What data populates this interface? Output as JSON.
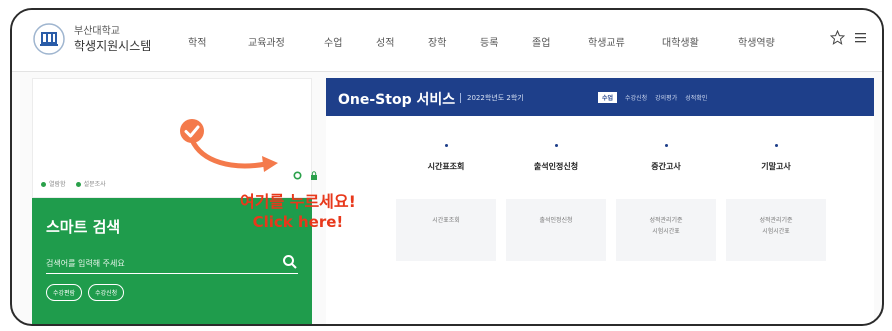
{
  "header": {
    "logo_line1": "부산대학교",
    "logo_line2": "학생지원시스템",
    "nav": [
      "학적",
      "교육과정",
      "수업",
      "성적",
      "장학",
      "등록",
      "졸업",
      "학생교류",
      "대학생활",
      "학생역량"
    ]
  },
  "left": {
    "meta": [
      "열람함",
      "설문조사"
    ]
  },
  "smart_search": {
    "title": "스마트 검색",
    "placeholder": "검색어를 입력해 주세요",
    "chips": [
      "수강편람",
      "수강신청"
    ]
  },
  "service": {
    "title": "One-Stop 서비스",
    "term": "2022학년도 2학기",
    "tabs": [
      "수업",
      "수강신청",
      "강의평가",
      "성적확인"
    ],
    "columns": [
      {
        "head": "시간표조회",
        "body": [
          "시간표조회"
        ]
      },
      {
        "head": "출석인정신청",
        "body": [
          "출석인정신청"
        ]
      },
      {
        "head": "중간고사",
        "body": [
          "성적관리기준",
          "시험시간표"
        ]
      },
      {
        "head": "기말고사",
        "body": [
          "성적관리기준",
          "시험시간표"
        ]
      }
    ]
  },
  "callout": {
    "korean": "여기를 누르세요!",
    "english": "Click here!"
  },
  "colors": {
    "green": "#1f9c4c",
    "navy": "#1e3f8a",
    "callout_orange": "#f47a4b",
    "callout_red": "#e8381b"
  }
}
